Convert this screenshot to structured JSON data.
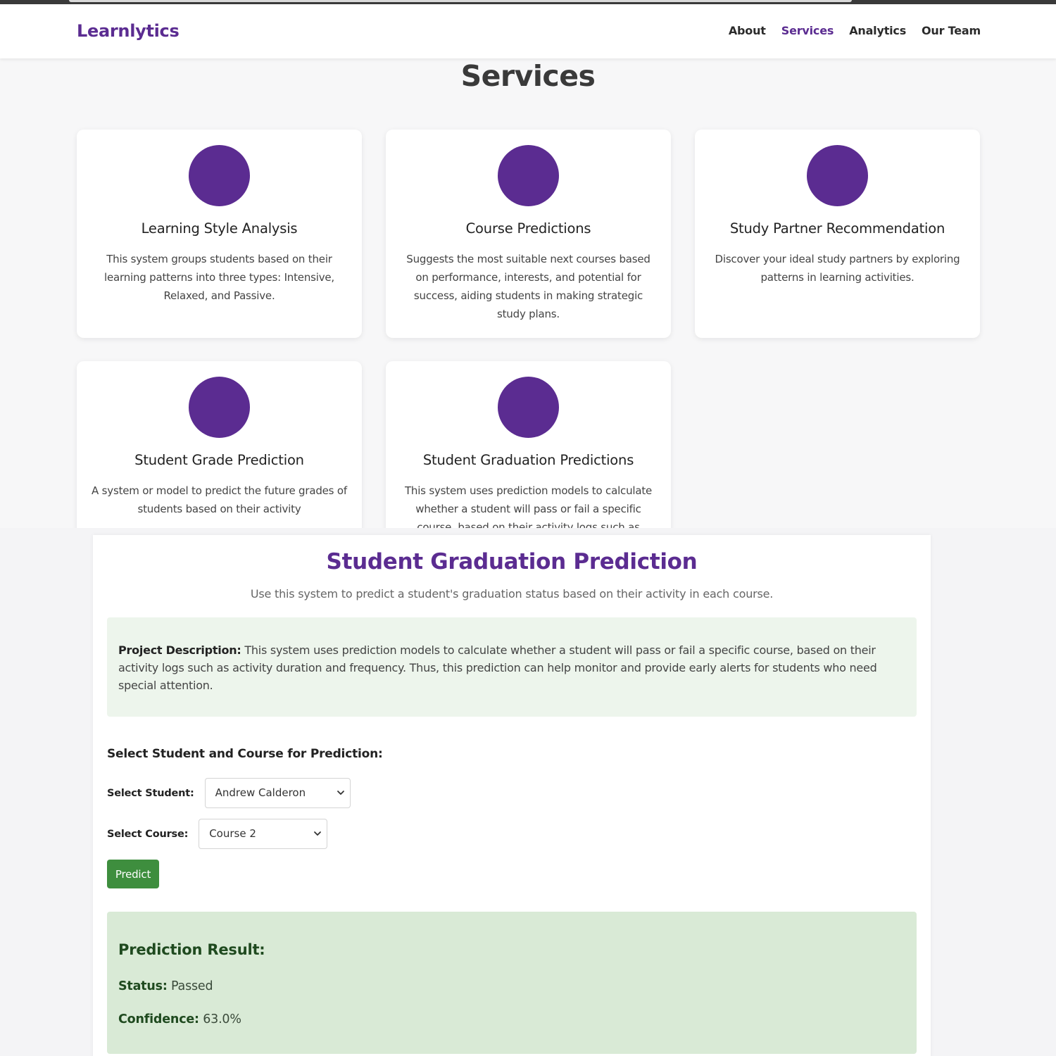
{
  "services_page": {
    "brand": "Learnlytics",
    "nav": [
      {
        "label": "About",
        "active": false
      },
      {
        "label": "Services",
        "active": true
      },
      {
        "label": "Analytics",
        "active": false
      },
      {
        "label": "Our Team",
        "active": false
      }
    ],
    "title": "Services",
    "cards": [
      {
        "title": "Learning Style Analysis",
        "text": "This system groups students based on their learning patterns into three types: Intensive, Relaxed, and Passive."
      },
      {
        "title": "Course Predictions",
        "text": "Suggests the most suitable next courses based on performance, interests, and potential for success, aiding students in making strategic study plans."
      },
      {
        "title": "Study Partner Recommendation",
        "text": "Discover your ideal study partners by exploring patterns in learning activities."
      },
      {
        "title": "Student Grade Prediction",
        "text": "A system or model to predict the future grades of students based on their activity"
      },
      {
        "title": "Student Graduation Predictions",
        "text": "This system uses prediction models to calculate whether a student will pass or fail a specific course, based on their activity logs such as"
      }
    ],
    "accent_color": "#5b2c91"
  },
  "prediction_page": {
    "title": "Student Graduation Prediction",
    "subtitle": "Use this system to predict a student's graduation status based on their activity in each course.",
    "description_label": "Project Description:",
    "description_text": " This system uses prediction models to calculate whether a student will pass or fail a specific course, based on their activity logs such as activity duration and frequency. Thus, this prediction can help monitor and provide early alerts for students who need special attention.",
    "form_heading": "Select Student and Course for Prediction:",
    "student_label": "Select Student:",
    "student_value": "Andrew Calderon",
    "course_label": "Select Course:",
    "course_value": "Course 2",
    "predict_button": "Predict",
    "result": {
      "title": "Prediction Result:",
      "status_label": "Status:",
      "status_value": " Passed",
      "confidence_label": "Confidence:",
      "confidence_value": " 63.0%"
    },
    "button_color": "#3e8e3e"
  }
}
